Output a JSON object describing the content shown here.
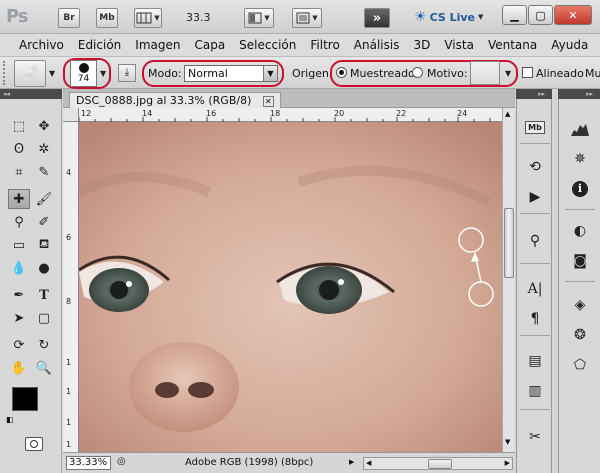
{
  "app": {
    "logo": "Ps",
    "buttons": [
      "Br",
      "Mb"
    ],
    "zoom_display": "33.3",
    "cs_live": "CS Live"
  },
  "menu": [
    "Archivo",
    "Edición",
    "Imagen",
    "Capa",
    "Selección",
    "Filtro",
    "Análisis",
    "3D",
    "Vista",
    "Ventana",
    "Ayuda"
  ],
  "options": {
    "brush_size": "74",
    "mode_label": "Modo:",
    "mode_value": "Normal",
    "source_label": "Origen:",
    "sampled_label": "Muestreado",
    "pattern_label": "Motivo:",
    "aligned_label": "Alineado",
    "truncated_label": "Mu"
  },
  "document": {
    "tab_title": "DSC_0888.jpg al 33.3% (RGB/8)",
    "ruler_h": [
      "12",
      "14",
      "16",
      "18",
      "20",
      "22",
      "24"
    ],
    "ruler_v": [
      "4",
      "6",
      "8",
      "1",
      "1",
      "1",
      "1"
    ],
    "zoom_field": "33.33%",
    "color_profile": "Adobe RGB (1998) (8bpc)"
  },
  "colors": {
    "accent_ring": "#c8102e",
    "foreground": "#000000",
    "background": "#ffffff"
  },
  "icons": {
    "left_tools": [
      "move-icon",
      "marquee-icon",
      "lasso-icon",
      "magic-wand-icon",
      "crop-icon",
      "eyedropper-icon",
      "healing-brush-icon",
      "brush-icon",
      "clone-stamp-icon",
      "history-brush-icon",
      "eraser-icon",
      "paint-bucket-icon",
      "blur-icon",
      "dodge-icon",
      "pen-icon",
      "type-icon",
      "path-select-icon",
      "shape-icon",
      "rotate-3d-icon",
      "orbit-3d-icon",
      "hand-icon",
      "zoom-icon"
    ],
    "right_panel_1": [
      "mini-bridge-icon",
      "history-icon",
      "actions-icon",
      "clone-source-icon",
      "character-icon",
      "paragraph-icon",
      "notes-icon",
      "measurement-icon",
      "tools-presets-icon"
    ],
    "right_panel_2": [
      "histogram-icon",
      "navigator-icon",
      "info-icon",
      "adjustments-icon",
      "masks-icon",
      "layers-icon",
      "channels-icon",
      "paths-icon"
    ]
  }
}
